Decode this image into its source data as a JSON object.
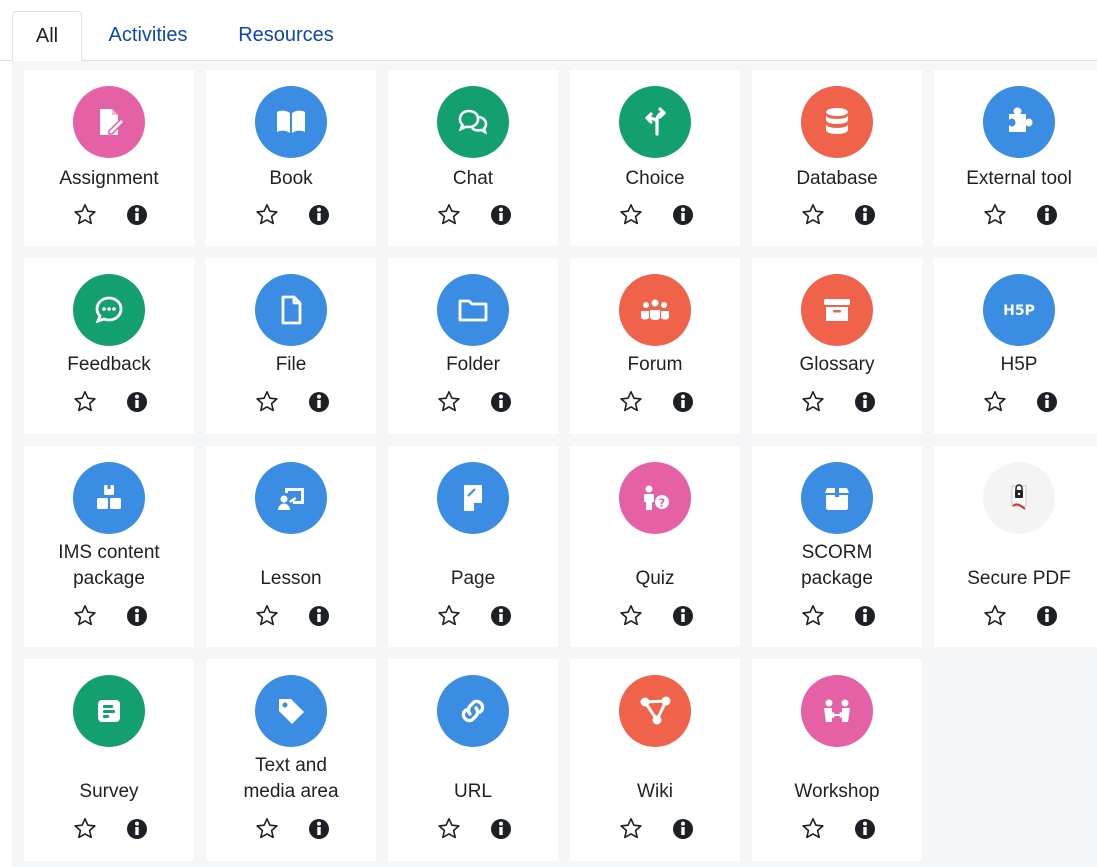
{
  "tabs": [
    {
      "label": "All",
      "active": true
    },
    {
      "label": "Activities",
      "active": false
    },
    {
      "label": "Resources",
      "active": false
    }
  ],
  "colors": {
    "pink": "#e660a5",
    "blue": "#3a8de3",
    "green": "#14a06e",
    "red": "#f0624a",
    "link": "#0f47ad"
  },
  "modules": [
    {
      "name": "Assignment",
      "icon": "assignment-icon",
      "color": "pink",
      "label_lines": 1
    },
    {
      "name": "Book",
      "icon": "book-icon",
      "color": "blue",
      "label_lines": 1
    },
    {
      "name": "Chat",
      "icon": "chat-icon",
      "color": "green",
      "label_lines": 1
    },
    {
      "name": "Choice",
      "icon": "choice-icon",
      "color": "green",
      "label_lines": 1
    },
    {
      "name": "Database",
      "icon": "database-icon",
      "color": "red",
      "label_lines": 1
    },
    {
      "name": "External tool",
      "icon": "puzzle-icon",
      "color": "blue",
      "label_lines": 1
    },
    {
      "name": "Feedback",
      "icon": "feedback-icon",
      "color": "green",
      "label_lines": 1
    },
    {
      "name": "File",
      "icon": "file-icon",
      "color": "blue",
      "label_lines": 1
    },
    {
      "name": "Folder",
      "icon": "folder-icon",
      "color": "blue",
      "label_lines": 1
    },
    {
      "name": "Forum",
      "icon": "forum-icon",
      "color": "red",
      "label_lines": 1
    },
    {
      "name": "Glossary",
      "icon": "glossary-icon",
      "color": "red",
      "label_lines": 1
    },
    {
      "name": "H5P",
      "icon": "h5p-icon",
      "color": "blue",
      "label_lines": 1,
      "icon_text": "H5P"
    },
    {
      "name": "IMS content package",
      "icon": "ims-package-icon",
      "color": "blue",
      "label_lines": 2
    },
    {
      "name": "Lesson",
      "icon": "lesson-icon",
      "color": "blue",
      "label_lines": 1
    },
    {
      "name": "Page",
      "icon": "page-icon",
      "color": "blue",
      "label_lines": 1
    },
    {
      "name": "Quiz",
      "icon": "quiz-icon",
      "color": "pink",
      "label_lines": 1
    },
    {
      "name": "SCORM package",
      "icon": "scorm-icon",
      "color": "blue",
      "label_lines": 2
    },
    {
      "name": "Secure PDF",
      "icon": "secure-pdf-icon",
      "color": "none",
      "label_lines": 1
    },
    {
      "name": "Survey",
      "icon": "survey-icon",
      "color": "green",
      "label_lines": 1
    },
    {
      "name": "Text and media area",
      "icon": "tag-icon",
      "color": "blue",
      "label_lines": 2
    },
    {
      "name": "URL",
      "icon": "link-icon",
      "color": "blue",
      "label_lines": 1
    },
    {
      "name": "Wiki",
      "icon": "wiki-icon",
      "color": "red",
      "label_lines": 1
    },
    {
      "name": "Workshop",
      "icon": "workshop-icon",
      "color": "pink",
      "label_lines": 1
    }
  ]
}
